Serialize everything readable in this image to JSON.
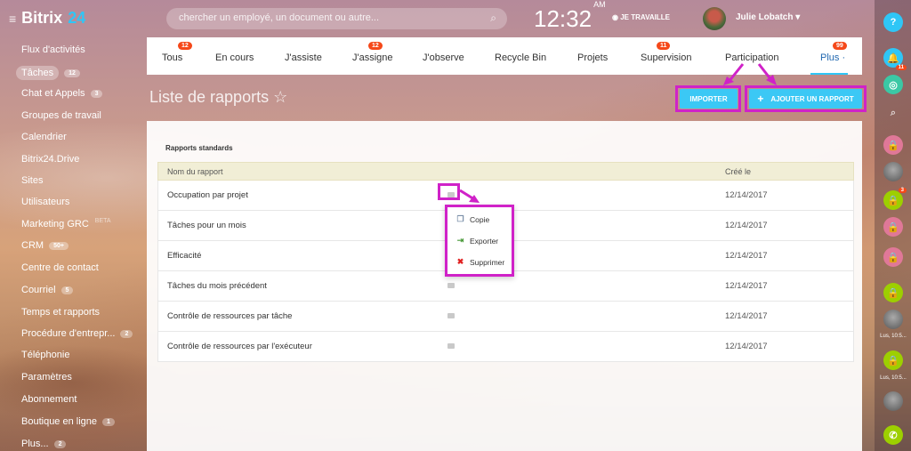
{
  "header": {
    "logo_text": "Bitrix",
    "logo_num": "24",
    "search_placeholder": "chercher un employé, un document ou autre...",
    "clock": "12:32",
    "clock_ampm": "AM",
    "work_status": "JE TRAVAILLE",
    "user_name": "Julie Lobatch"
  },
  "sidebar": {
    "items": [
      {
        "label": "Flux d'activités",
        "count": ""
      },
      {
        "label": "Tâches",
        "count": "12"
      },
      {
        "label": "Chat et Appels",
        "count": "3"
      },
      {
        "label": "Groupes de travail",
        "count": ""
      },
      {
        "label": "Calendrier",
        "count": ""
      },
      {
        "label": "Bitrix24.Drive",
        "count": ""
      },
      {
        "label": "Sites",
        "count": ""
      },
      {
        "label": "Utilisateurs",
        "count": ""
      },
      {
        "label": "Marketing GRC",
        "count": "BETA"
      },
      {
        "label": "CRM",
        "count": "50+"
      },
      {
        "label": "Centre de contact",
        "count": ""
      },
      {
        "label": "Courriel",
        "count": "5"
      },
      {
        "label": "Temps et rapports",
        "count": ""
      },
      {
        "label": "Procédure d'entrepr...",
        "count": "2"
      },
      {
        "label": "Téléphonie",
        "count": ""
      },
      {
        "label": "Paramètres",
        "count": ""
      },
      {
        "label": "Abonnement",
        "count": ""
      },
      {
        "label": "Boutique en ligne",
        "count": "1"
      },
      {
        "label": "Plus...",
        "count": "2"
      }
    ]
  },
  "tabs": [
    {
      "label": "Tous",
      "badge": "12"
    },
    {
      "label": "En cours",
      "badge": ""
    },
    {
      "label": "J'assiste",
      "badge": ""
    },
    {
      "label": "J'assigne",
      "badge": "12"
    },
    {
      "label": "J'observe",
      "badge": ""
    },
    {
      "label": "Recycle Bin",
      "badge": ""
    },
    {
      "label": "Projets",
      "badge": ""
    },
    {
      "label": "Supervision",
      "badge": "11"
    },
    {
      "label": "Participation",
      "badge": ""
    },
    {
      "label": "Plus",
      "badge": "99"
    }
  ],
  "page": {
    "title": "Liste de rapports",
    "import_button": "IMPORTER",
    "add_button": "AJOUTER UN RAPPORT",
    "section_title": "Rapports standards"
  },
  "table": {
    "columns": [
      "Nom du rapport",
      "Créé le"
    ],
    "rows": [
      {
        "name": "Occupation par projet",
        "date": "12/14/2017"
      },
      {
        "name": "Tâches pour un mois",
        "date": "12/14/2017"
      },
      {
        "name": "Efficacité",
        "date": "12/14/2017"
      },
      {
        "name": "Tâches du mois précédent",
        "date": "12/14/2017"
      },
      {
        "name": "Contrôle de ressources par tâche",
        "date": "12/14/2017"
      },
      {
        "name": "Contrôle de ressources par l'exécuteur",
        "date": "12/14/2017"
      }
    ]
  },
  "row_menu": {
    "items": [
      {
        "label": "Copie",
        "icon": "copy-icon"
      },
      {
        "label": "Exporter",
        "icon": "export-icon"
      },
      {
        "label": "Supprimer",
        "icon": "delete-icon"
      }
    ]
  },
  "rightbar": {
    "notif_count": "11",
    "badge_3": "3",
    "cap_1": "Lus, 10:5...",
    "cap_2": "Lus, 10:5..."
  },
  "colors": {
    "accent": "#2fc6f6",
    "highlight": "#d022c8",
    "badge": "#f54819"
  }
}
